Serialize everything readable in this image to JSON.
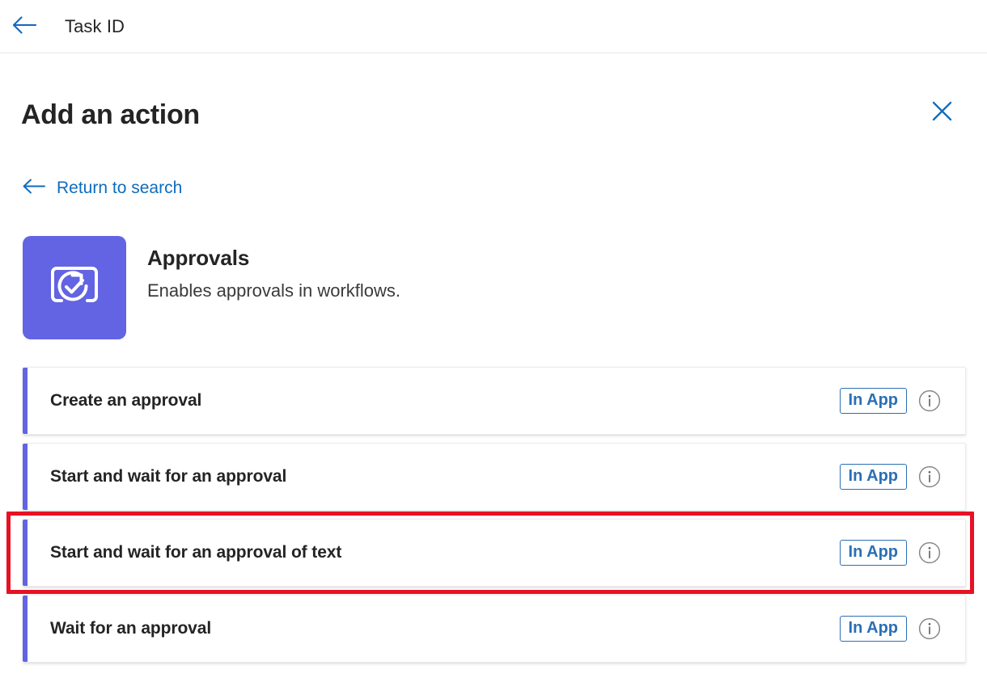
{
  "topbar": {
    "back_icon": "arrow-left-icon",
    "title": "Task ID"
  },
  "panel": {
    "title": "Add an action",
    "close_icon": "close-icon",
    "return_link": {
      "icon": "arrow-left-icon",
      "label": "Return to search"
    }
  },
  "connector": {
    "logo_icon": "approvals-icon",
    "logo_color": "#6264e3",
    "name": "Approvals",
    "description": "Enables approvals in workflows."
  },
  "actions": [
    {
      "label": "Create an approval",
      "badge": "In App",
      "info_icon": "info-circle-icon",
      "highlighted": false
    },
    {
      "label": "Start and wait for an approval",
      "badge": "In App",
      "info_icon": "info-circle-icon",
      "highlighted": false
    },
    {
      "label": "Start and wait for an approval of text",
      "badge": "In App",
      "info_icon": "info-circle-icon",
      "highlighted": true
    },
    {
      "label": "Wait for an approval",
      "badge": "In App",
      "info_icon": "info-circle-icon",
      "highlighted": false
    }
  ],
  "colors": {
    "accent_purple": "#6264e3",
    "link_blue": "#0f6cbd",
    "badge_blue": "#2a6fb5",
    "highlight_red": "#e81123",
    "text_primary": "#242424"
  }
}
